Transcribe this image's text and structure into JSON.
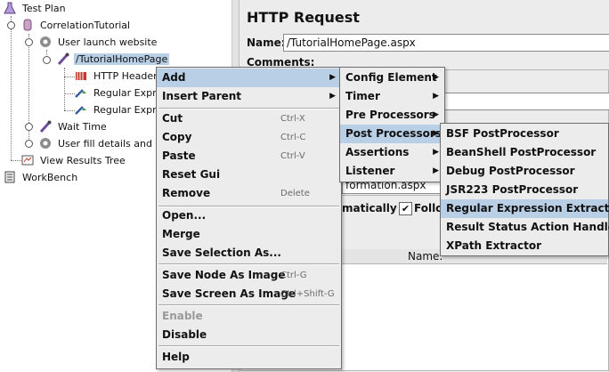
{
  "tree": {
    "items": [
      {
        "label": "Test Plan",
        "icon": "test-plan-icon"
      },
      {
        "label": "CorrelationTutorial",
        "icon": "thread-group-icon"
      },
      {
        "label": "User launch website",
        "icon": "gear-icon"
      },
      {
        "label": "/TutorialHomePage",
        "icon": "sampler-icon"
      },
      {
        "label": "HTTP Header b",
        "icon": "header-manager-icon"
      },
      {
        "label": "Regular Expre",
        "icon": "extractor-icon"
      },
      {
        "label": "Regular Expre",
        "icon": "extractor-icon"
      },
      {
        "label": "Wait Time",
        "icon": "sampler-icon"
      },
      {
        "label": "User fill details and clic",
        "icon": "gear-icon"
      },
      {
        "label": "View Results Tree",
        "icon": "listener-icon"
      },
      {
        "label": "WorkBench",
        "icon": "workbench-icon"
      }
    ]
  },
  "panel": {
    "title": "HTTP Request",
    "name_label": "Name:",
    "name_value": "/TutorialHomePage.aspx",
    "comments_label": "Comments:",
    "path_fragment": "formation.aspx",
    "auto_fragment": "matically",
    "follow_fragment": "Follo",
    "follow_checked": "✔",
    "table_header": "Name:"
  },
  "context_menu": {
    "add": "Add",
    "insert_parent": "Insert Parent",
    "cut": "Cut",
    "cut_sc": "Ctrl-X",
    "copy": "Copy",
    "copy_sc": "Ctrl-C",
    "paste": "Paste",
    "paste_sc": "Ctrl-V",
    "reset_gui": "Reset Gui",
    "remove": "Remove",
    "remove_sc": "Delete",
    "open": "Open...",
    "merge": "Merge",
    "save_selection": "Save Selection As...",
    "save_node_image": "Save Node As Image",
    "save_node_image_sc": "Ctrl-G",
    "save_screen_image": "Save Screen As Image",
    "save_screen_image_sc": "Ctrl+Shift-G",
    "enable": "Enable",
    "disable": "Disable",
    "help": "Help"
  },
  "add_menu": {
    "config_element": "Config Element",
    "timer": "Timer",
    "pre_processors": "Pre Processors",
    "post_processors": "Post Processors",
    "assertions": "Assertions",
    "listener": "Listener"
  },
  "post_menu": {
    "items": [
      "BSF PostProcessor",
      "BeanShell PostProcessor",
      "Debug PostProcessor",
      "JSR223 PostProcessor",
      "Regular Expression Extractor",
      "Result Status Action Handler",
      "XPath Extractor"
    ]
  },
  "colors": {
    "highlight": "#b8cfe5",
    "menu_bg": "#ececec"
  }
}
